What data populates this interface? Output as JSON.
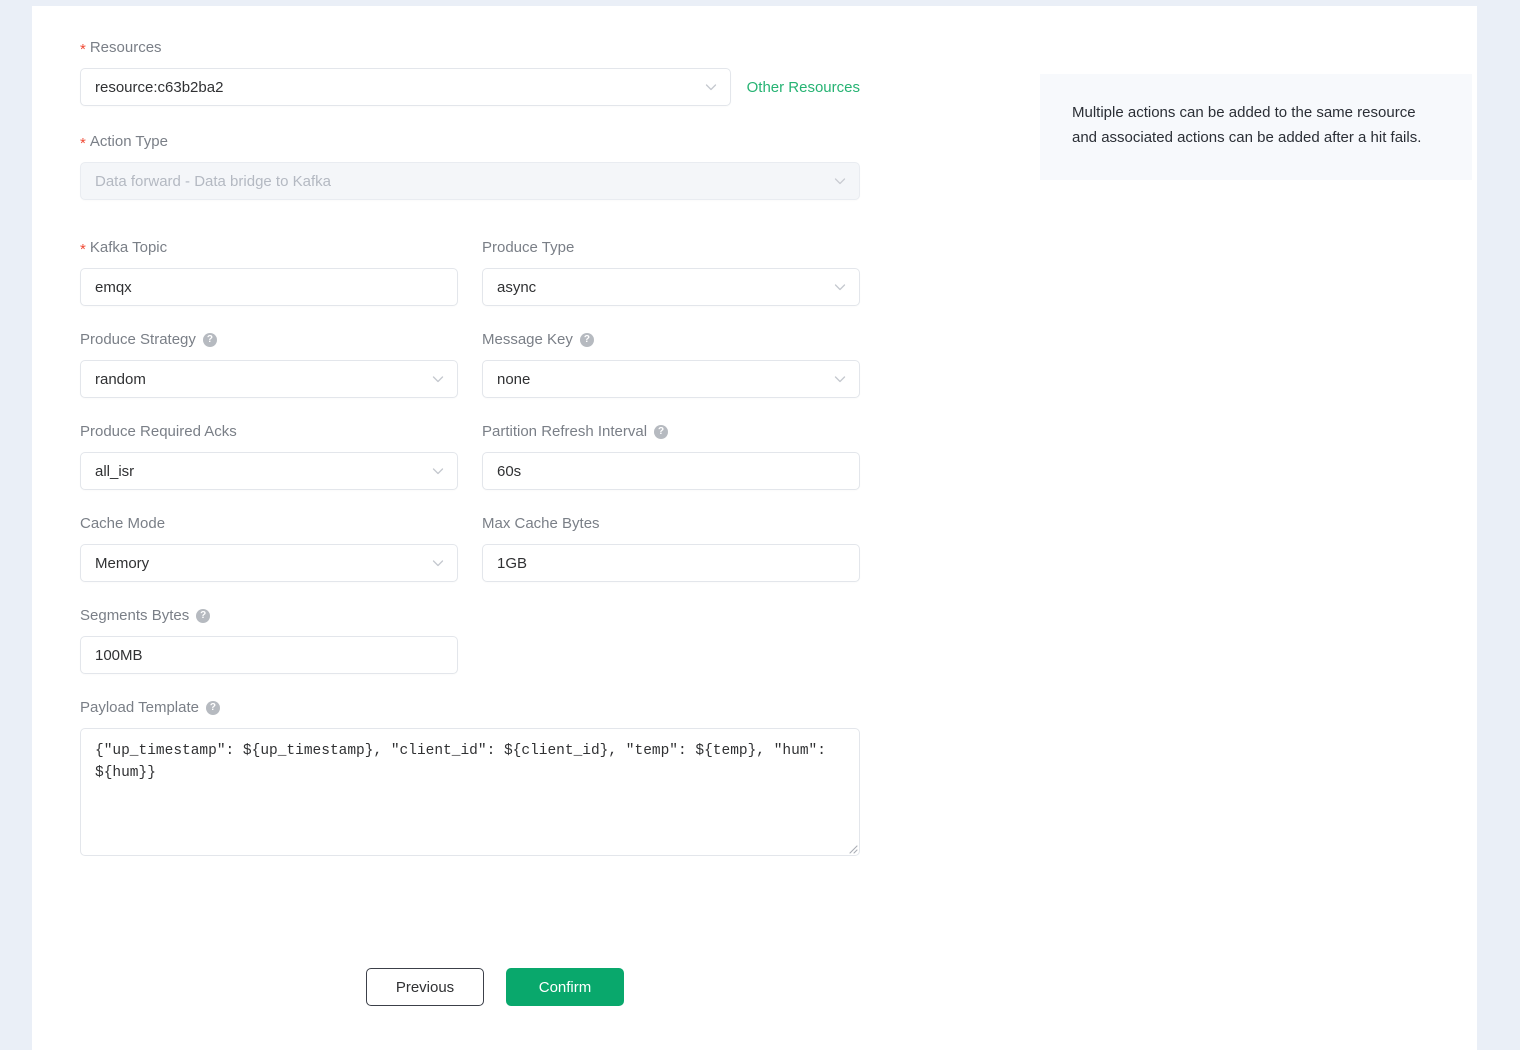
{
  "form": {
    "resources": {
      "label": "Resources",
      "required": true,
      "value": "resource:c63b2ba2",
      "other_resources_link": "Other Resources"
    },
    "action_type": {
      "label": "Action Type",
      "required": true,
      "value": "Data forward - Data bridge to Kafka",
      "disabled": true
    },
    "kafka_topic": {
      "label": "Kafka Topic",
      "required": true,
      "value": "emqx"
    },
    "produce_type": {
      "label": "Produce Type",
      "value": "async"
    },
    "produce_strategy": {
      "label": "Produce Strategy",
      "has_help": true,
      "value": "random"
    },
    "message_key": {
      "label": "Message Key",
      "has_help": true,
      "value": "none"
    },
    "produce_required_acks": {
      "label": "Produce Required Acks",
      "value": "all_isr"
    },
    "partition_refresh_interval": {
      "label": "Partition Refresh Interval",
      "has_help": true,
      "value": "60s"
    },
    "cache_mode": {
      "label": "Cache Mode",
      "value": "Memory"
    },
    "max_cache_bytes": {
      "label": "Max Cache Bytes",
      "value": "1GB"
    },
    "segments_bytes": {
      "label": "Segments Bytes",
      "has_help": true,
      "value": "100MB"
    },
    "payload_template": {
      "label": "Payload Template",
      "has_help": true,
      "value": "{\"up_timestamp\": ${up_timestamp}, \"client_id\": ${client_id}, \"temp\": ${temp}, \"hum\": ${hum}}"
    }
  },
  "footer": {
    "previous_label": "Previous",
    "confirm_label": "Confirm"
  },
  "info_panel": {
    "text": "Multiple actions can be added to the same resource and associated actions can be added after a hit fails."
  },
  "icons": {
    "help": "?",
    "chevron_down": "chevron-down-icon"
  },
  "colors": {
    "accent_green": "#09a86c",
    "link_green": "#26b373",
    "required_star": "#f04a35",
    "page_background": "#eaeff7",
    "card_background": "#ffffff",
    "info_panel_background": "#f7f9fc",
    "border": "#e3e6eb",
    "label_text": "#7a7f87",
    "value_text": "#303133",
    "disabled_text": "#b4b9c2"
  }
}
